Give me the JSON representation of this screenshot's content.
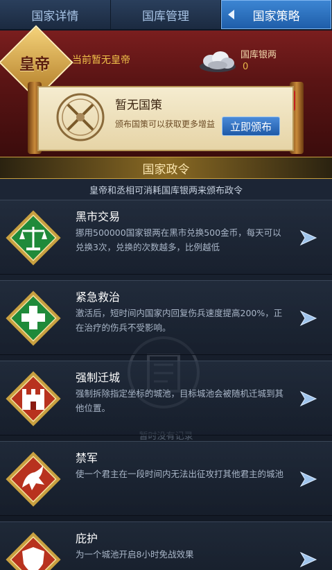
{
  "tabs": [
    {
      "label": "国家详情",
      "active": false
    },
    {
      "label": "国库管理",
      "active": false
    },
    {
      "label": "国家策略",
      "active": true
    }
  ],
  "emperor": {
    "seal_text": "皇帝",
    "status": "当前暂无皇帝",
    "treasury_label": "国库银两",
    "treasury_value": "0"
  },
  "decree": {
    "title": "暂无国策",
    "description": "颁布国策可以获取更多增益",
    "issue_button": "立即颁布"
  },
  "section": {
    "title": "国家政令",
    "subtitle": "皇帝和丞相可消耗国库银两来颁布政令"
  },
  "empty_state": {
    "text": "暂时没有记录"
  },
  "policies": [
    {
      "title": "黑市交易",
      "description": "挪用500000国家银两在黑市兑换500金币，每天可以兑换3次，兑换的次数越多，比例越低",
      "icon": "scales-icon",
      "color": "#1f8a3a"
    },
    {
      "title": "紧急救治",
      "description": "激活后，短时间内国家内回复伤兵速度提高200%，正在治疗的伤兵不受影响。",
      "icon": "medical-cross-icon",
      "color": "#1f8a3a"
    },
    {
      "title": "强制迁城",
      "description": "强制拆除指定坐标的城池，目标城池会被随机迁城到其他位置。",
      "icon": "castle-icon",
      "color": "#b8321e"
    },
    {
      "title": "禁军",
      "description": "使一个君主在一段时间内无法出征攻打其他君主的城池",
      "icon": "pegasus-icon",
      "color": "#b8321e"
    },
    {
      "title": "庇护",
      "description": "为一个城池开启8小时免战效果",
      "icon": "shield-icon",
      "color": "#b8321e"
    }
  ]
}
